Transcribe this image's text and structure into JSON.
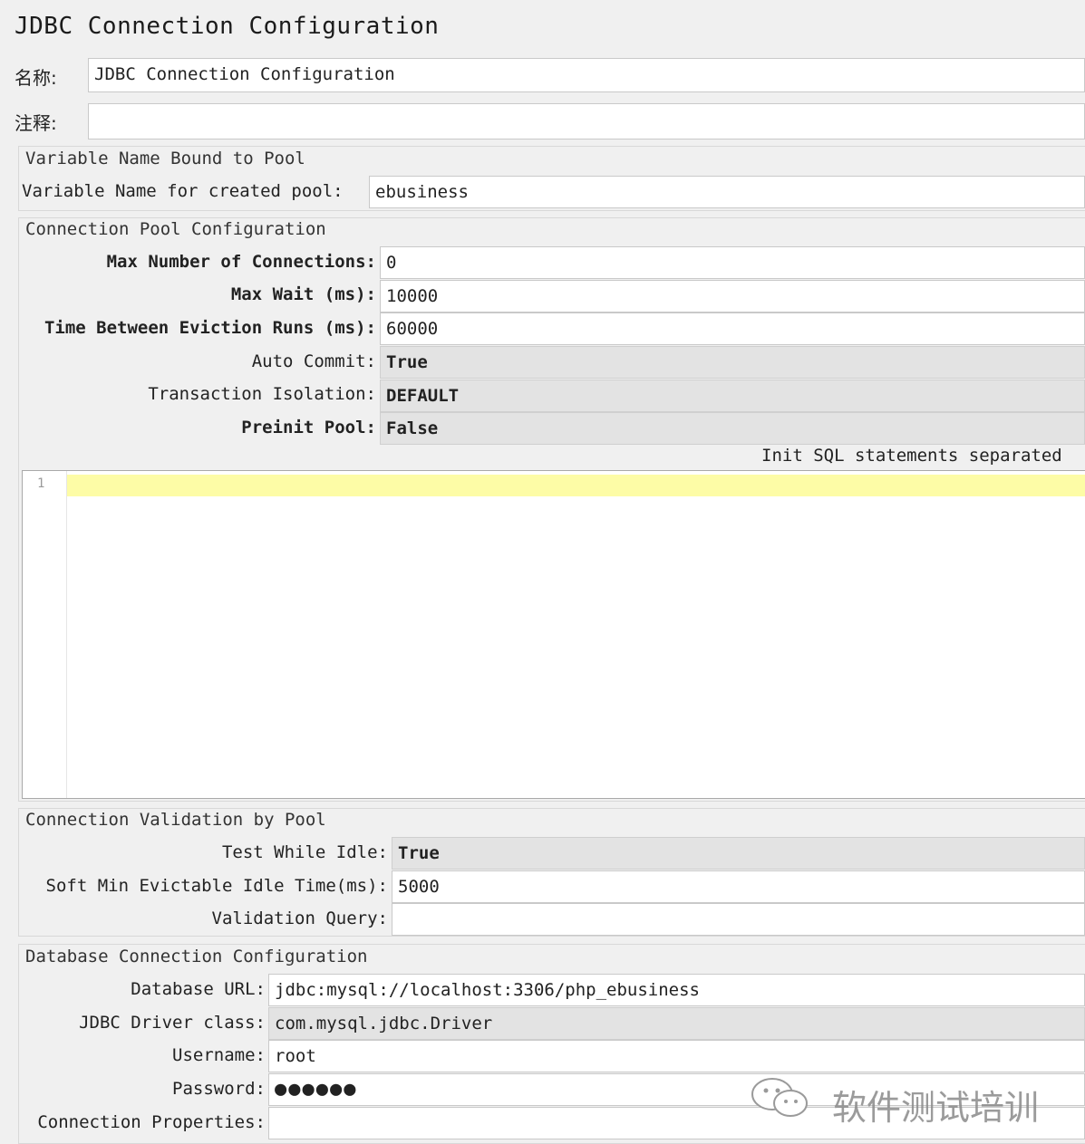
{
  "panel": {
    "title": "JDBC Connection Configuration",
    "name_label": "名称:",
    "name_value": "JDBC Connection Configuration",
    "comment_label": "注释:",
    "comment_value": ""
  },
  "variable_section": {
    "title": "Variable Name Bound to Pool",
    "pool_var_label": "Variable Name for created pool:",
    "pool_var_value": "ebusiness"
  },
  "pool_section": {
    "title": "Connection Pool Configuration",
    "max_connections_label": "Max Number of Connections:",
    "max_connections_value": "0",
    "max_wait_label": "Max Wait (ms):",
    "max_wait_value": "10000",
    "eviction_label": "Time Between Eviction Runs (ms):",
    "eviction_value": "60000",
    "auto_commit_label": "Auto Commit:",
    "auto_commit_value": "True",
    "isolation_label": "Transaction Isolation:",
    "isolation_value": "DEFAULT",
    "preinit_label": "Preinit Pool:",
    "preinit_value": "False",
    "init_sql_label": "Init SQL statements separated",
    "editor_line_number": "1"
  },
  "validation_section": {
    "title": "Connection Validation by Pool",
    "test_idle_label": "Test While Idle:",
    "test_idle_value": "True",
    "soft_min_label": "Soft Min Evictable Idle Time(ms):",
    "soft_min_value": "5000",
    "validation_query_label": "Validation Query:",
    "validation_query_value": ""
  },
  "database_section": {
    "title": "Database Connection Configuration",
    "url_label": "Database URL:",
    "url_value": "jdbc:mysql://localhost:3306/php_ebusiness",
    "driver_label": "JDBC Driver class:",
    "driver_value": "com.mysql.jdbc.Driver",
    "username_label": "Username:",
    "username_value": "root",
    "password_label": "Password:",
    "password_mask": "●●●●●●",
    "properties_label": "Connection Properties:",
    "properties_value": ""
  },
  "watermark": {
    "text": "软件测试培训",
    "icon": "wechat-icon"
  }
}
